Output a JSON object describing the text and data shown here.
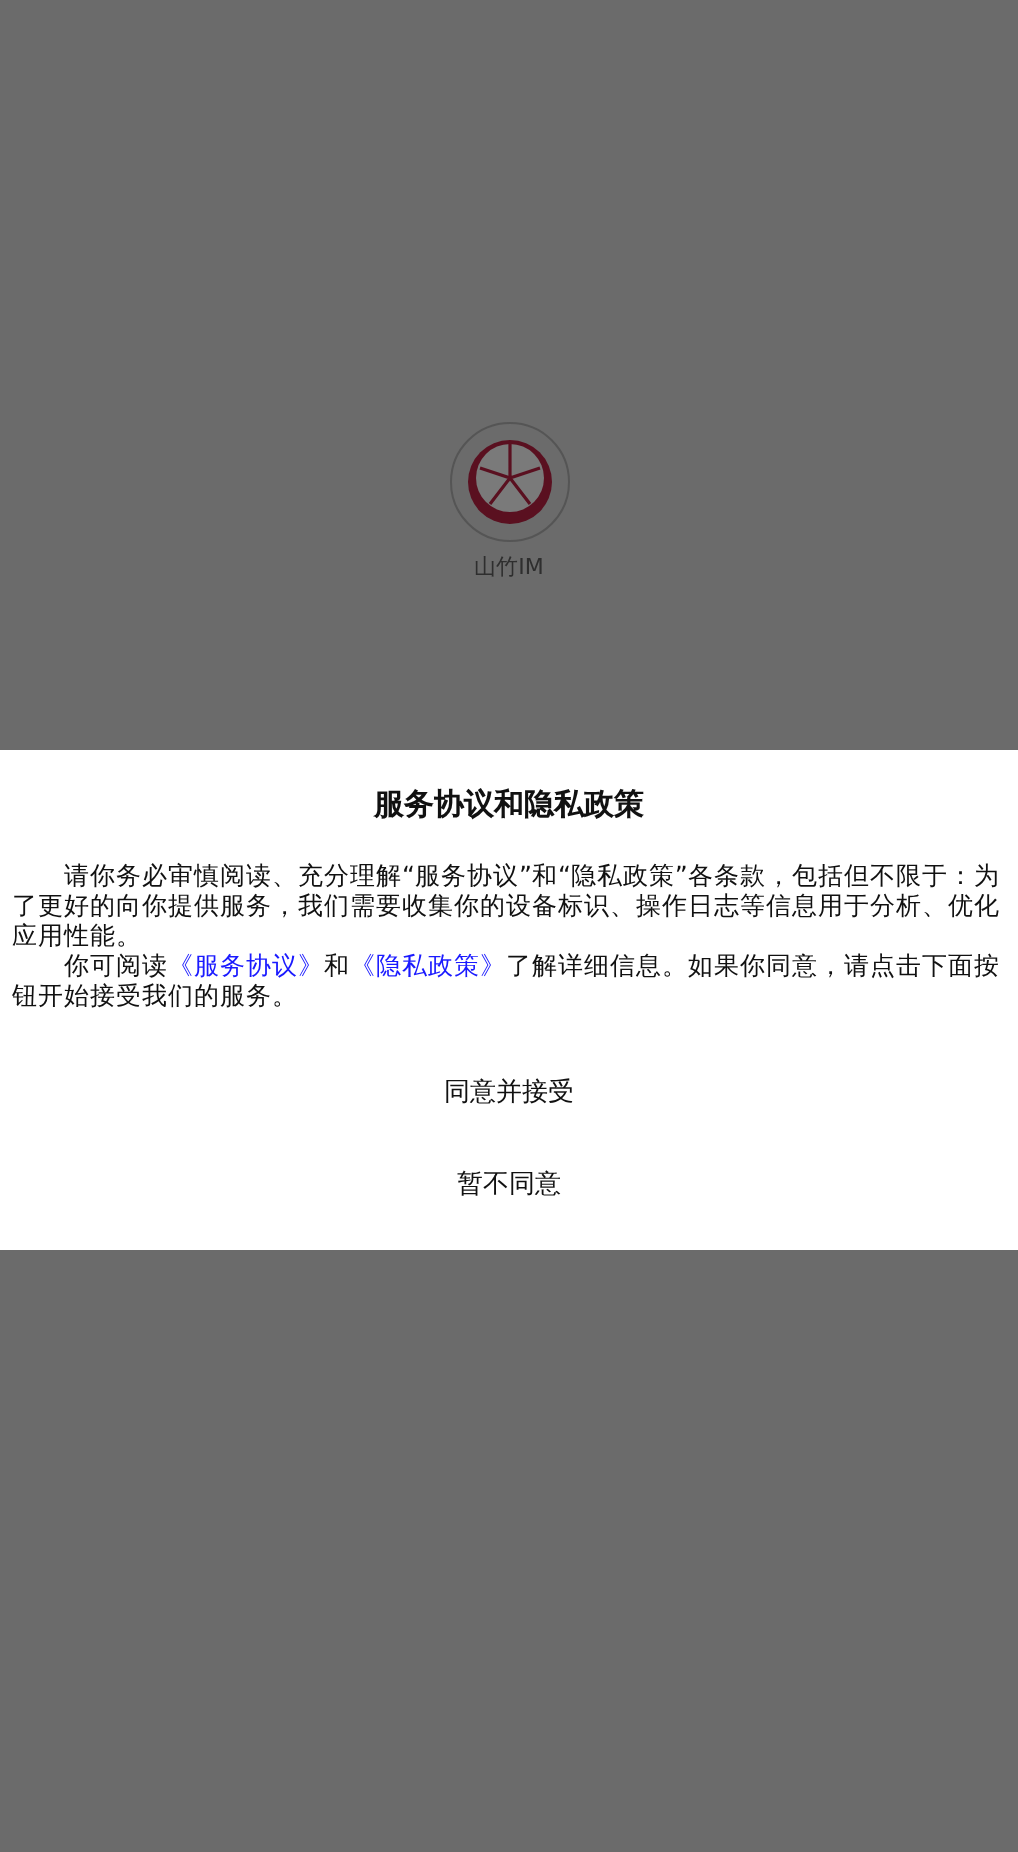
{
  "splash": {
    "app_name": "山竹IM"
  },
  "dialog": {
    "title": "服务协议和隐私政策",
    "paragraphs": [
      [
        {
          "kind": "text",
          "text": "请你务必审慎阅读、充分理解“服务协议”和“隐私政策”各条款，包括但不限于：为了更好的向你提供服务，我们需要收集你的设备标识、操作日志等信息用于分析、优化应用性能。"
        }
      ],
      [
        {
          "kind": "text",
          "text": "你可阅读"
        },
        {
          "kind": "link",
          "text": "《服务协议》"
        },
        {
          "kind": "text",
          "text": "和"
        },
        {
          "kind": "link",
          "text": "《隐私政策》"
        },
        {
          "kind": "text",
          "text": "了解详细信息。如果你同意，请点击下面按钮开始接受我们的服务。"
        }
      ]
    ],
    "buttons": [
      "同意并接受",
      "暂不同意"
    ]
  }
}
